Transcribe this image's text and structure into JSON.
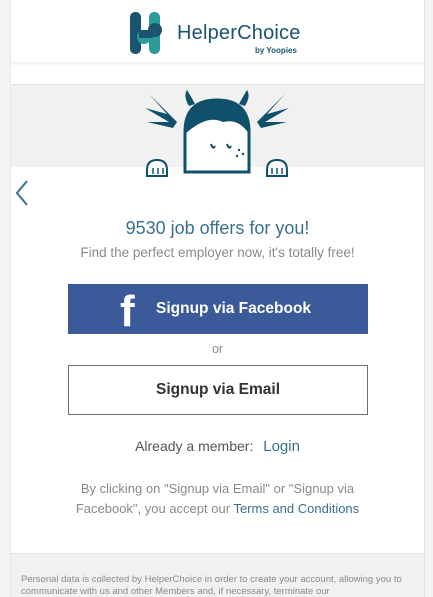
{
  "brand": {
    "name_part1": "Helper",
    "name_part2": "Choice",
    "by_line": "by Yoopies",
    "color_dark": "#1a5470",
    "color_teal": "#2b9c98"
  },
  "nav": {
    "back_icon": "chevron-left-icon"
  },
  "hero": {
    "headline": "9530 job offers for you!",
    "subline": "Find the perfect employer now, it's totally free!"
  },
  "actions": {
    "facebook_label": "Signup via Facebook",
    "facebook_icon": "f",
    "or_label": "or",
    "email_label": "Signup via Email"
  },
  "member": {
    "prompt": "Already a member:",
    "login_label": "Login"
  },
  "legal": {
    "text": "By clicking on \"Signup via Email\" or \"Signup via Facebook\", you accept our",
    "terms_link": "Terms and Conditions"
  },
  "footer": {
    "text": "Personal data is collected by HelperChoice in order to create your account, allowing you to communicate with us and other Members and, if necessary, terminate our"
  },
  "colors": {
    "facebook_blue": "#3b5a9a",
    "link_blue": "#3b6f8f",
    "hero_bg": "#f1f1f1"
  }
}
